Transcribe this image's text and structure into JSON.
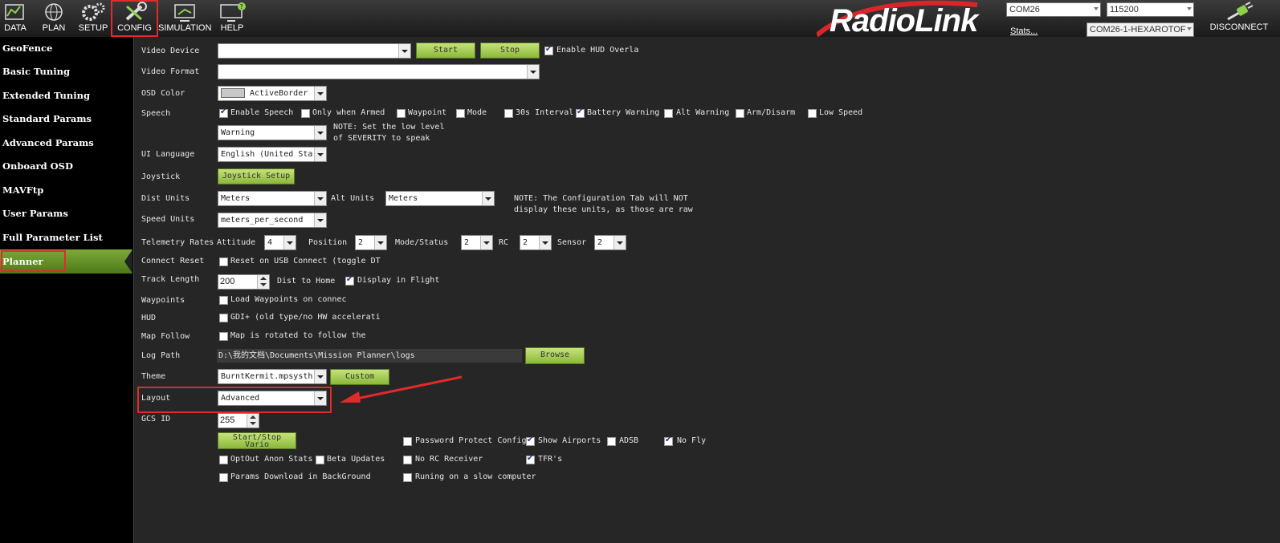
{
  "toolbar": {
    "buttons": [
      {
        "label": "DATA",
        "icon": "data-icon"
      },
      {
        "label": "PLAN",
        "icon": "globe-icon"
      },
      {
        "label": "SETUP",
        "icon": "gears-icon"
      },
      {
        "label": "CONFIG",
        "icon": "wrench-icon"
      },
      {
        "label": "SIMULATION",
        "icon": "simulation-icon"
      },
      {
        "label": "HELP",
        "icon": "help-monitor-icon"
      }
    ],
    "logo": "RadioLink",
    "com_port": "COM26",
    "baud_rate": "115200",
    "stats_link": "Stats...",
    "connection": "COM26-1-HEXAROTOF",
    "disconnect_label": "DISCONNECT",
    "accent_color": "#e02b2b"
  },
  "sidebar": {
    "items": [
      "GeoFence",
      "Basic Tuning",
      "Extended Tuning",
      "Standard Params",
      "Advanced Params",
      "Onboard OSD",
      "MAVFtp",
      "User Params",
      "Full Parameter List",
      "Planner"
    ],
    "active": "Planner"
  },
  "planner": {
    "video_device": {
      "label": "Video Device",
      "value": "",
      "start": "Start",
      "stop": "Stop",
      "hud_overlay": "Enable HUD Overla"
    },
    "video_format": {
      "label": "Video Format",
      "value": ""
    },
    "osd_color": {
      "label": "OSD Color",
      "value": "ActiveBorder"
    },
    "speech": {
      "label": "Speech",
      "options": [
        {
          "label": "Enable Speech",
          "checked": true
        },
        {
          "label": "Only when Armed",
          "checked": false
        },
        {
          "label": "Waypoint",
          "checked": false
        },
        {
          "label": "Mode",
          "checked": false
        },
        {
          "label": "30s Interval",
          "checked": false
        },
        {
          "label": "Battery Warning",
          "checked": true
        },
        {
          "label": "Alt Warning",
          "checked": false
        },
        {
          "label": "Arm/Disarm",
          "checked": false
        },
        {
          "label": "Low Speed",
          "checked": false
        }
      ],
      "severity": "Warning",
      "note_line1": "NOTE: Set the low level",
      "note_line2": "of SEVERITY to speak"
    },
    "ui_language": {
      "label": "UI Language",
      "value": "English (United Sta"
    },
    "joystick": {
      "label": "Joystick",
      "button": "Joystick Setup"
    },
    "dist_units": {
      "label": "Dist Units",
      "value": "Meters"
    },
    "alt_units": {
      "label": "Alt Units",
      "value": "Meters"
    },
    "units_note_line1": "NOTE: The Configuration Tab will NOT",
    "units_note_line2": "display these units, as those are raw",
    "speed_units": {
      "label": "Speed Units",
      "value": "meters_per_second"
    },
    "telemetry": {
      "label": "Telemetry Rates",
      "attitude_label": "Attitude",
      "attitude": "4",
      "position_label": "Position",
      "position": "2",
      "mode_label": "Mode/Status",
      "mode": "2",
      "rc_label": "RC",
      "rc": "2",
      "sensor_label": "Sensor",
      "sensor": "2"
    },
    "connect_reset": {
      "label": "Connect Reset",
      "option": "Reset on USB Connect (toggle DT",
      "checked": false
    },
    "track_length": {
      "label": "Track Length",
      "value": "200",
      "dist_to_home": "Dist to Home",
      "display_in_flight": "Display in Flight",
      "display_checked": true
    },
    "waypoints": {
      "label": "Waypoints",
      "option": "Load Waypoints on connec",
      "checked": false
    },
    "hud": {
      "label": "HUD",
      "option": "GDI+ (old type/no HW accelerati",
      "checked": false
    },
    "map_follow": {
      "label": "Map Follow",
      "option": "Map is rotated to follow the",
      "checked": false
    },
    "log_path": {
      "label": "Log Path",
      "value": "D:\\我的文档\\Documents\\Mission Planner\\logs",
      "browse": "Browse"
    },
    "theme": {
      "label": "Theme",
      "value": "BurntKermit.mpsysth",
      "custom": "Custom"
    },
    "layout": {
      "label": "Layout",
      "value": "Advanced"
    },
    "gcs_id": {
      "label": "GCS ID",
      "value": "255"
    },
    "start_stop_vario": "Start/Stop Vario",
    "extra": {
      "password_protect": {
        "label": "Password Protect Config",
        "checked": false
      },
      "show_airports": {
        "label": "Show Airports",
        "checked": true
      },
      "adsb": {
        "label": "ADSB",
        "checked": false
      },
      "no_fly": {
        "label": "No Fly",
        "checked": true
      },
      "optout": {
        "label": "OptOut Anon Stats",
        "checked": false
      },
      "beta_updates": {
        "label": "Beta Updates",
        "checked": false
      },
      "no_rc_receiver": {
        "label": "No RC Receiver",
        "checked": false
      },
      "tfrs": {
        "label": "TFR's",
        "checked": true
      },
      "params_download": {
        "label": "Params Download in BackGround",
        "checked": false
      },
      "slow_computer": {
        "label": "Runing on a slow computer",
        "checked": false
      }
    }
  }
}
